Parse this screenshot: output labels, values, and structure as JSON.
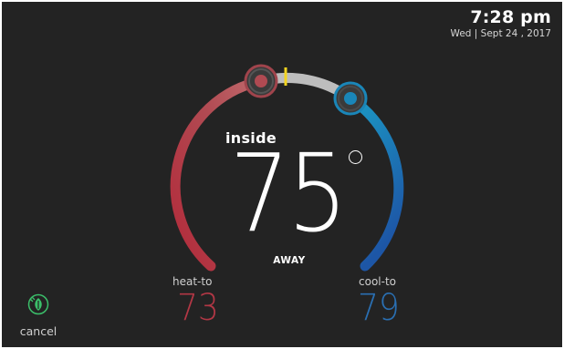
{
  "clock": {
    "time": "7:28 pm",
    "date": "Wed | Sept 24 , 2017"
  },
  "thermostat": {
    "inside_label": "inside",
    "inside_temp": "75",
    "mode": "AWAY",
    "heat_to_label": "heat-to",
    "heat_to_value": "73",
    "cool_to_label": "cool-to",
    "cool_to_value": "79",
    "heat_color": "#b23745",
    "cool_color": "#2a6fb2",
    "neutral_arc_color": "#bdbdbd",
    "current_marker_color": "#f2d41f"
  },
  "cancel": {
    "label": "cancel",
    "icon": "leaf-plug-icon",
    "icon_color": "#3bbf6a"
  }
}
